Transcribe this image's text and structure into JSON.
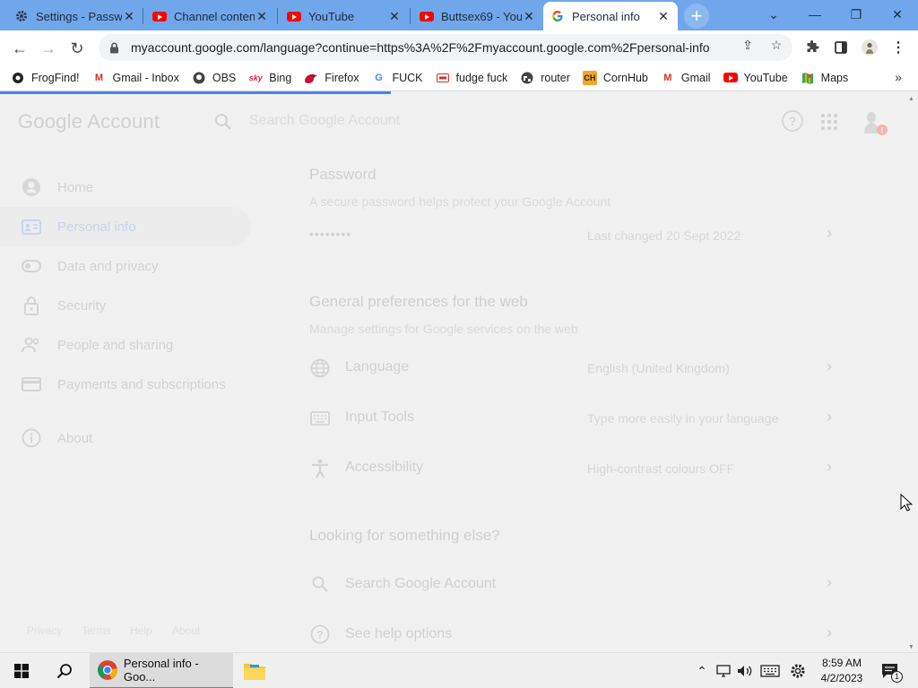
{
  "tabs": [
    {
      "title": "Settings - Passw",
      "icon": "gear-icon"
    },
    {
      "title": "Channel content",
      "icon": "youtube-icon"
    },
    {
      "title": "YouTube",
      "icon": "youtube-icon"
    },
    {
      "title": "Buttsex69 - You",
      "icon": "youtube-icon"
    },
    {
      "title": "Personal info",
      "icon": "google-icon",
      "active": true
    }
  ],
  "toolbar": {
    "url": "myaccount.google.com/language?continue=https%3A%2F%2Fmyaccount.google.com%2Fpersonal-info"
  },
  "bookmarks": [
    {
      "label": "FrogFind!",
      "icon": "frog-icon"
    },
    {
      "label": "Gmail - Inbox",
      "icon": "gmail-icon"
    },
    {
      "label": "OBS",
      "icon": "github-icon"
    },
    {
      "label": "Bing",
      "icon": "sky-icon"
    },
    {
      "label": "Firefox",
      "icon": "firefox-icon"
    },
    {
      "label": "FUCK",
      "icon": "google-icon"
    },
    {
      "label": "fudge fuck",
      "icon": "bookmark-icon"
    },
    {
      "label": "router",
      "icon": "globe-icon"
    },
    {
      "label": "CornHub",
      "icon": "ch-icon"
    },
    {
      "label": "Gmail",
      "icon": "gmail-icon"
    },
    {
      "label": "YouTube",
      "icon": "youtube-icon"
    },
    {
      "label": "Maps",
      "icon": "maps-icon"
    }
  ],
  "header": {
    "logo_google": "Google",
    "logo_account": "Account",
    "search_placeholder": "Search Google Account"
  },
  "sidebar": {
    "items": [
      {
        "label": "Home"
      },
      {
        "label": "Personal info",
        "active": true
      },
      {
        "label": "Data and privacy"
      },
      {
        "label": "Security"
      },
      {
        "label": "People and sharing"
      },
      {
        "label": "Payments and subscriptions"
      },
      {
        "label": "About"
      }
    ],
    "footer": [
      "Privacy",
      "Terms",
      "Help",
      "About"
    ]
  },
  "password": {
    "title": "Password",
    "subtitle": "A secure password helps protect your Google Account",
    "masked": "••••••••",
    "last_changed": "Last changed 20 Sept 2022"
  },
  "preferences": {
    "title": "General preferences for the web",
    "subtitle": "Manage settings for Google services on the web",
    "rows": [
      {
        "label": "Language",
        "value": "English (United Kingdom)",
        "icon": "globe-icon"
      },
      {
        "label": "Input Tools",
        "value": "Type more easily in your language",
        "icon": "keyboard-icon"
      },
      {
        "label": "Accessibility",
        "value": "High-contrast colours OFF",
        "icon": "accessibility-icon"
      }
    ]
  },
  "else": {
    "title": "Looking for something else?",
    "rows": [
      {
        "label": "Search Google Account",
        "icon": "search-icon"
      },
      {
        "label": "See help options",
        "icon": "help-icon"
      }
    ]
  },
  "taskbar": {
    "chrome_label": "Personal info - Goo...",
    "time": "8:59 AM",
    "date": "4/2/2023",
    "notification_count": "1"
  },
  "colors": {
    "tabstrip": "#6fa7ea",
    "accent": "#4285f4",
    "youtube_red": "#ff0000"
  }
}
